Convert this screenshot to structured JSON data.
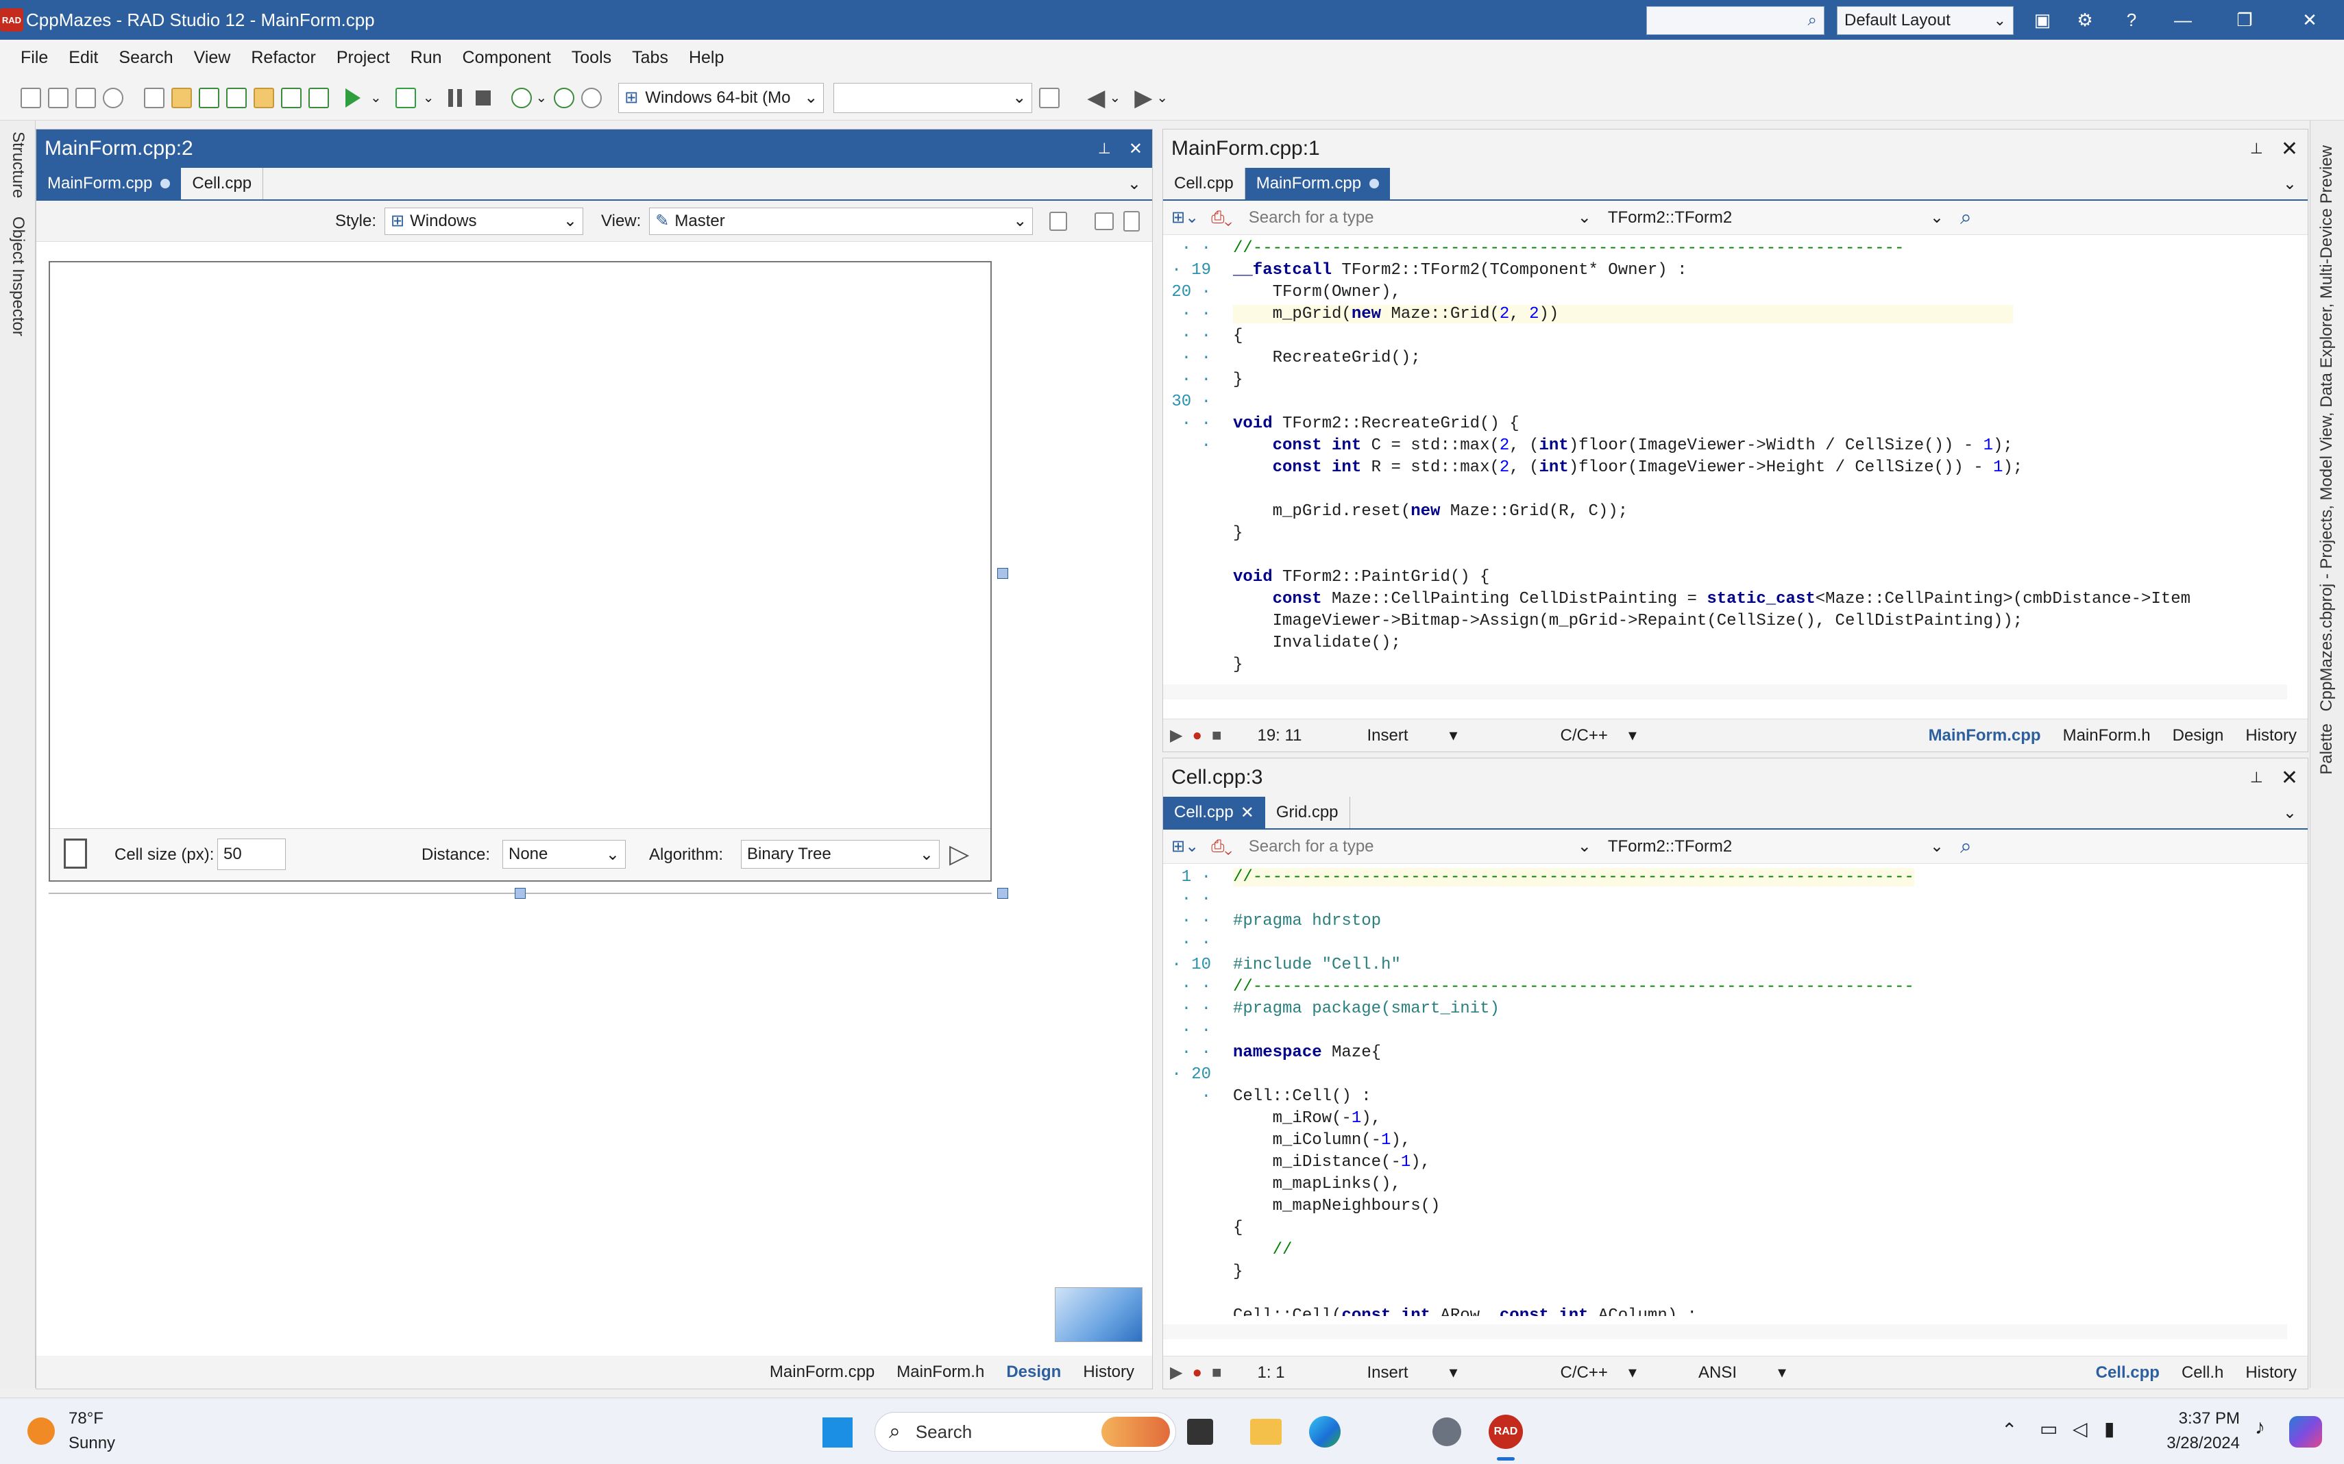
{
  "window": {
    "title": "CppMazes - RAD Studio 12 - MainForm.cpp",
    "logo_text": "RAD",
    "layout_combo": "Default Layout"
  },
  "menu": [
    "File",
    "Edit",
    "Search",
    "View",
    "Refactor",
    "Project",
    "Run",
    "Component",
    "Tools",
    "Tabs",
    "Help"
  ],
  "toolbar": {
    "platform": "Windows 64-bit (Mo"
  },
  "left_strip": {
    "structure": "Structure",
    "object_inspector": "Object Inspector"
  },
  "right_strip": {
    "text": "CppMazes.cbproj - Projects, Model View, Data Explorer, Multi-Device Preview",
    "palette": "Palette"
  },
  "design": {
    "header": "MainForm.cpp:2",
    "tabs": [
      "MainForm.cpp",
      "Cell.cpp"
    ],
    "style_label": "Style:",
    "style_value": "Windows",
    "view_label": "View:",
    "view_value": "Master",
    "cell_size_label": "Cell size (px):",
    "cell_size_value": "50",
    "distance_label": "Distance:",
    "distance_value": "None",
    "algorithm_label": "Algorithm:",
    "algorithm_value": "Binary Tree",
    "bottom_tabs": [
      "MainForm.cpp",
      "MainForm.h",
      "Design",
      "History"
    ]
  },
  "editor1": {
    "header": "MainForm.cpp:1",
    "tabs": [
      "Cell.cpp",
      "MainForm.cpp"
    ],
    "search_placeholder": "Search for a type",
    "scope": "TForm2::TForm2",
    "position": "19:  11",
    "mode": "Insert",
    "lang": "C/C++",
    "bottom_tabs": [
      "MainForm.cpp",
      "MainForm.h",
      "Design",
      "History"
    ]
  },
  "editor2": {
    "header": "Cell.cpp:3",
    "tabs": [
      "Cell.cpp",
      "Grid.cpp"
    ],
    "search_placeholder": "Search for a type",
    "scope": "TForm2::TForm2",
    "position": "1:   1",
    "mode": "Insert",
    "lang": "C/C++",
    "encoding": "ANSI",
    "bottom_tabs": [
      "Cell.cpp",
      "Cell.h",
      "History"
    ]
  },
  "taskbar": {
    "temp": "78°F",
    "weather": "Sunny",
    "search": "Search",
    "time": "3:37 PM",
    "date": "3/28/2024"
  },
  "colors": {
    "accent": "#2d5f9e",
    "title_bar": "#2d5f9e",
    "rad_red": "#c42b1c"
  }
}
